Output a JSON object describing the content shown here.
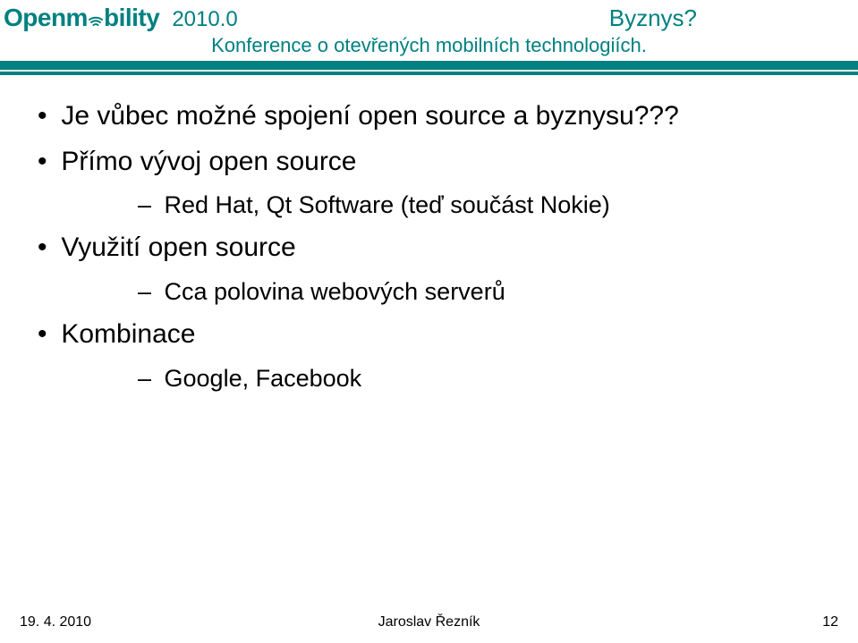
{
  "header": {
    "brand_main": "Openm",
    "brand_tail": "bility",
    "version": "2010.0",
    "slide_title": "Byznys?",
    "subtitle": "Konference o otevřených mobilních technologiích.",
    "logo_accent_hex": "#008080"
  },
  "bullets": {
    "l1a": "Je vůbec možné spojení open source a byznysu???",
    "l1b": "Přímo vývoj open source",
    "l2a": "Red Hat, Qt Software (teď součást Nokie)",
    "l1c": "Využití open source",
    "l2b": "Cca polovina webových serverů",
    "l1d": "Kombinace",
    "l2c": "Google, Facebook"
  },
  "footer": {
    "date": "19. 4. 2010",
    "author": "Jaroslav Řezník",
    "page": "12"
  },
  "markers": {
    "dot": "•",
    "dash": "–"
  }
}
